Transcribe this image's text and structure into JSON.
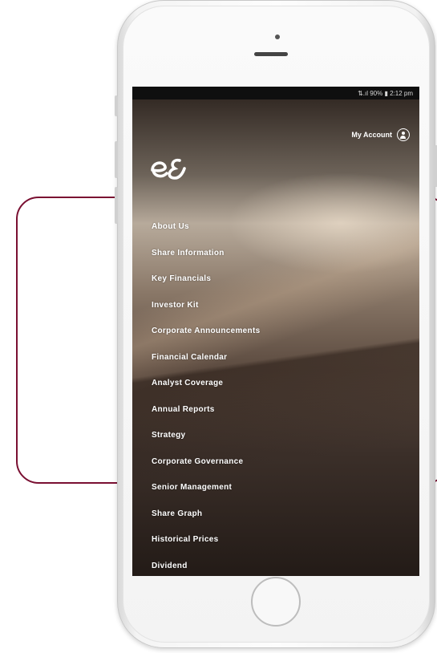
{
  "status_bar": {
    "text": "⇅.ıl 90% ▮ 2:12 pm"
  },
  "header": {
    "account_label": "My Account",
    "logo_icon": "e-and-logo-icon",
    "account_icon": "user-circle-icon"
  },
  "menu": {
    "items": [
      {
        "label": "About Us"
      },
      {
        "label": "Share Information"
      },
      {
        "label": "Key Financials"
      },
      {
        "label": "Investor Kit"
      },
      {
        "label": "Corporate Announcements"
      },
      {
        "label": "Financial Calendar"
      },
      {
        "label": "Analyst Coverage"
      },
      {
        "label": "Annual Reports"
      },
      {
        "label": "Strategy"
      },
      {
        "label": "Corporate Governance"
      },
      {
        "label": "Senior Management"
      },
      {
        "label": "Share Graph"
      },
      {
        "label": "Historical Prices"
      },
      {
        "label": "Dividend"
      }
    ]
  },
  "colors": {
    "bracket": "#7a1032",
    "menu_text": "#ffffff"
  }
}
